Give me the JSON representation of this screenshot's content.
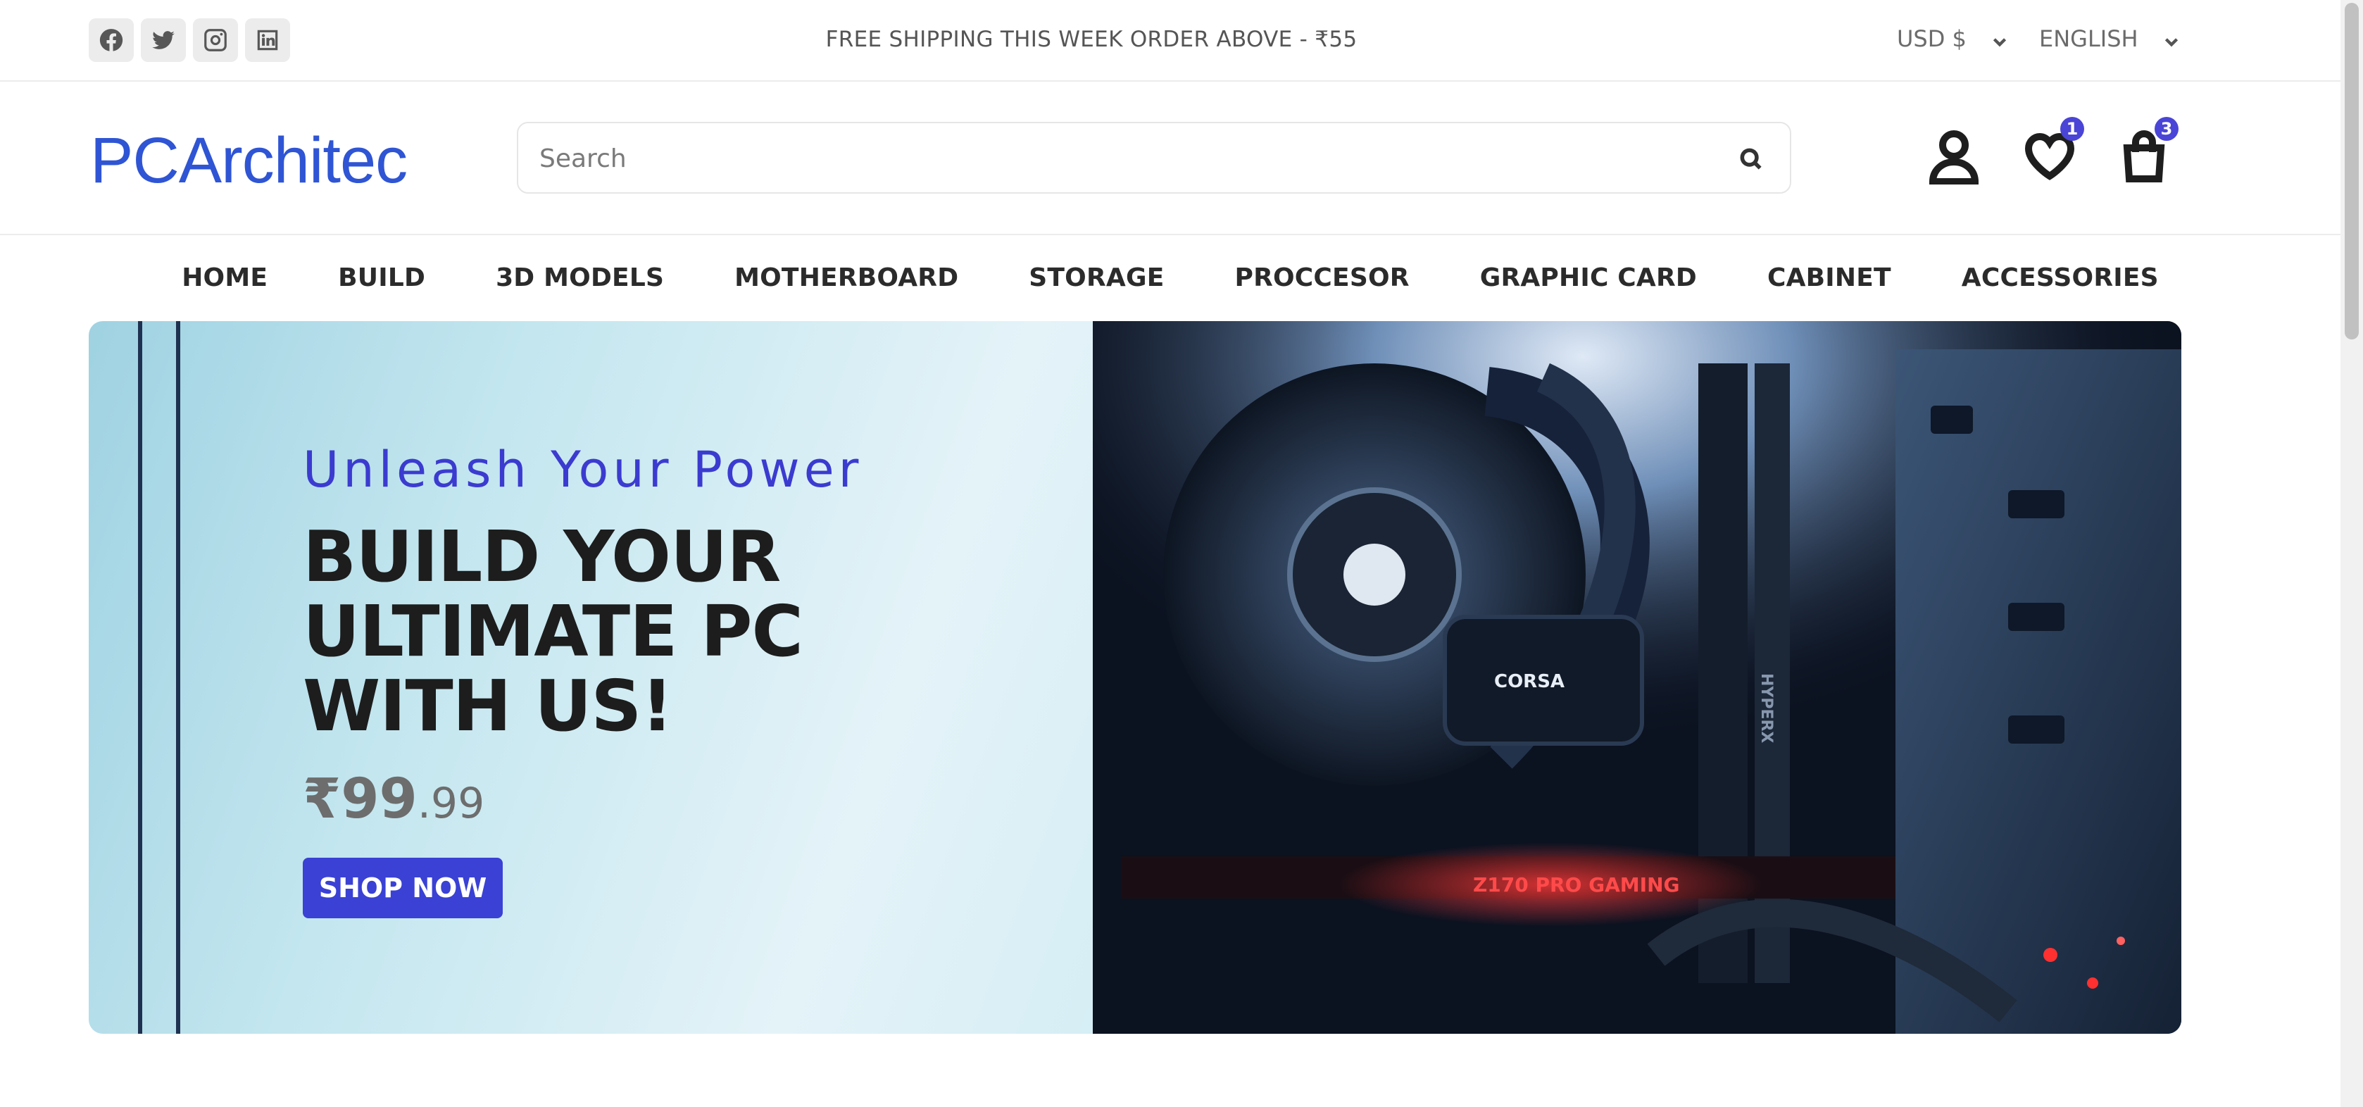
{
  "topbar": {
    "shipping_text": "FREE SHIPPING THIS WEEK ORDER ABOVE - ₹55",
    "currency": "USD $",
    "language": "ENGLISH",
    "socials": [
      "facebook-icon",
      "twitter-icon",
      "instagram-icon",
      "linkedin-icon"
    ]
  },
  "header": {
    "logo": "PCArchitec",
    "search_placeholder": "Search",
    "wishlist_count": "1",
    "cart_count": "3"
  },
  "nav": {
    "items": [
      "HOME",
      "BUILD",
      "3D MODELS",
      "MOTHERBOARD",
      "STORAGE",
      "PROCCESOR",
      "GRAPHIC CARD",
      "CABINET",
      "ACCESSORIES"
    ]
  },
  "hero": {
    "tagline": "Unleash Your Power",
    "headline": "BUILD YOUR ULTIMATE PC WITH US!",
    "price_main": "₹99",
    "price_cents": ".99",
    "cta": "SHOP NOW",
    "image_text": {
      "brand": "CORSA",
      "ram": "HYPERX",
      "board": "Z170 PRO GAMING"
    }
  },
  "colors": {
    "accent": "#3a41d4",
    "logo": "#2f55d4",
    "tagline": "#3b3bd0"
  }
}
